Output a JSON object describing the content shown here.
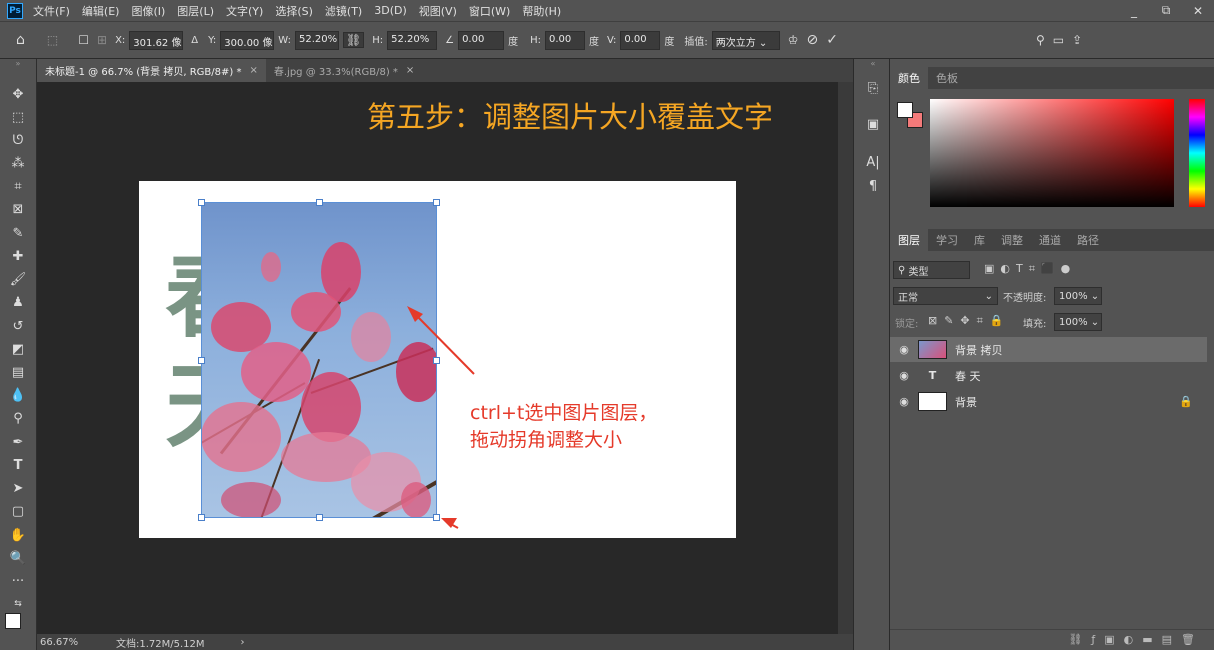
{
  "menu": {
    "logo": "Ps",
    "items": [
      "文件(F)",
      "编辑(E)",
      "图像(I)",
      "图层(L)",
      "文字(Y)",
      "选择(S)",
      "滤镜(T)",
      "3D(D)",
      "视图(V)",
      "窗口(W)",
      "帮助(H)"
    ]
  },
  "window_controls": {
    "minimize": "_",
    "restore": "⧉",
    "close": "✕"
  },
  "options": {
    "x_label": "X:",
    "x_value": "301.62 像素",
    "delta_label": "Δ",
    "y_label": "Y:",
    "y_value": "300.00 像素",
    "w_label": "W:",
    "w_value": "52.20%",
    "h_label": "H:",
    "h_value": "52.20%",
    "angle_value": "0.00",
    "angle_unit": "度",
    "hskew_label": "H:",
    "hskew_value": "0.00",
    "hskew_unit": "度",
    "vskew_label": "V:",
    "vskew_value": "0.00",
    "vskew_unit": "度",
    "interp_label": "插值:",
    "interp_value": "两次立方"
  },
  "tabs": [
    {
      "label": "未标题-1 @ 66.7% (背景 拷贝, RGB/8#) *",
      "close": "×"
    },
    {
      "label": "春.jpg @ 33.3%(RGB/8) *",
      "close": "×"
    }
  ],
  "canvas": {
    "heading": "第五步：调整图片大小覆盖文字",
    "bg_text": "春天",
    "annotation_line1": "ctrl+t选中图片图层，",
    "annotation_line2": "拖动拐角调整大小",
    "accent_heading": "#f5a623",
    "accent_annotation": "#e53a2a"
  },
  "status": {
    "zoom": "66.67%",
    "doc_info": "文档:1.72M/5.12M",
    "arrow": "›"
  },
  "color_panel": {
    "tabs": [
      "颜色",
      "色板"
    ],
    "foreground": "#ffffff",
    "background": "#f47a7a"
  },
  "layers_panel": {
    "tabs": [
      "图层",
      "学习",
      "库",
      "调整",
      "通道",
      "路径"
    ],
    "filter_placeholder": "类型",
    "blend_mode": "正常",
    "opacity_label": "不透明度:",
    "opacity_value": "100%",
    "lock_label": "锁定:",
    "fill_label": "填充:",
    "fill_value": "100%",
    "layers": [
      {
        "name": "背景 拷贝",
        "type": "image",
        "selected": true
      },
      {
        "name": "春 天",
        "type": "text",
        "selected": false
      },
      {
        "name": "背景",
        "type": "fill",
        "selected": false,
        "locked": true
      }
    ]
  }
}
